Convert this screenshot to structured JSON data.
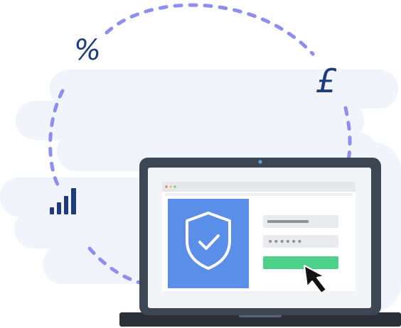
{
  "illustration": {
    "symbols": {
      "percent": "%",
      "pound": "£"
    },
    "login_form": {
      "password_mask": "••••••",
      "username_value": "",
      "password_value": "••••••"
    },
    "colors": {
      "background_cloud": "#f1f5fb",
      "orbit_dash": "#8d8ef0",
      "symbol_ink": "#1f3c7a",
      "laptop_frame": "#3d4653",
      "laptop_base": "#2b3038",
      "browser_bg": "#ffffff",
      "browser_chrome": "#e6e8ec",
      "shield_panel": "#5b8ee6",
      "shield_outline": "#ffffff",
      "input_bg": "#e9ebee",
      "input_line": "#8f9399",
      "submit_button": "#4fd08a",
      "cursor": "#111111",
      "signal_bars": "#1f3c7a"
    },
    "icons": {
      "shield": "shield-check-icon",
      "cursor": "mouse-pointer-icon",
      "signal": "signal-bars-icon"
    }
  }
}
